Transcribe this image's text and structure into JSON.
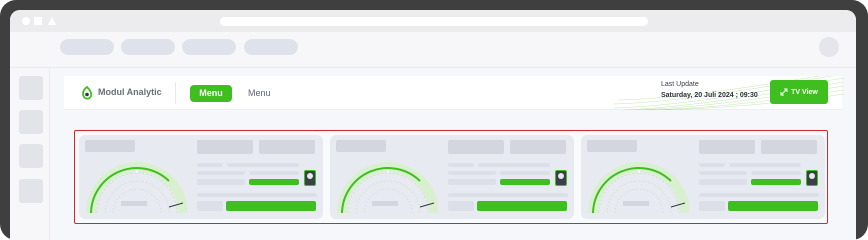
{
  "app": {
    "name": "Modul Analytic",
    "menu_active_label": "Menu",
    "menu_link_label": "Menu",
    "last_update_label": "Last Update",
    "last_update_value": "Saturday, 20 Juli 2024 ; 09:30",
    "tv_view_label": "TV View"
  },
  "icons": {
    "logo": "leaf-logo-icon",
    "tv_view": "expand-arrows-icon",
    "card_toggle": "toggle-icon"
  },
  "colors": {
    "accent": "#3fbf1f",
    "highlight_border": "#d8252a",
    "device_frame": "#3f3f3f"
  },
  "cards": [
    {
      "name": "card-1"
    },
    {
      "name": "card-2"
    },
    {
      "name": "card-3"
    }
  ]
}
